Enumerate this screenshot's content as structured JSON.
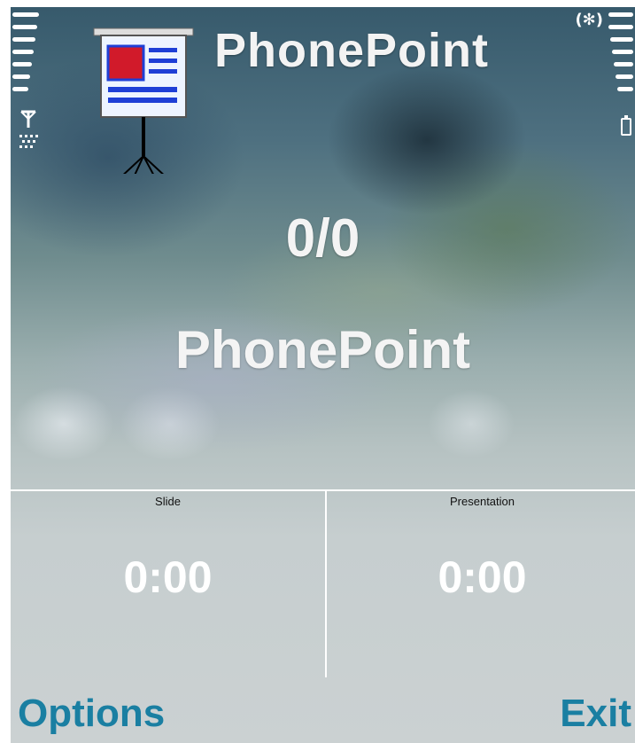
{
  "app": {
    "title": "PhonePoint"
  },
  "status_bar": {
    "signal_icon": "signal-strength-bars",
    "antenna_icon": "antenna-icon",
    "battery_icon": "battery-icon",
    "bluetooth_icon": "bluetooth-icon",
    "bluetooth_label": "(✻)",
    "signal_level": 7,
    "battery_level": 7
  },
  "main": {
    "slide_counter": "0/0",
    "presentation_name": "PhonePoint"
  },
  "timers": {
    "slide": {
      "label": "Slide",
      "value": "0:00"
    },
    "presentation": {
      "label": "Presentation",
      "value": "0:00"
    }
  },
  "softkeys": {
    "left": "Options",
    "right": "Exit"
  },
  "colors": {
    "softkey": "#1a7fa2",
    "text": "#f4f4f4",
    "icon_screen_red": "#d11a2a",
    "icon_screen_blue": "#1f3fd6"
  }
}
